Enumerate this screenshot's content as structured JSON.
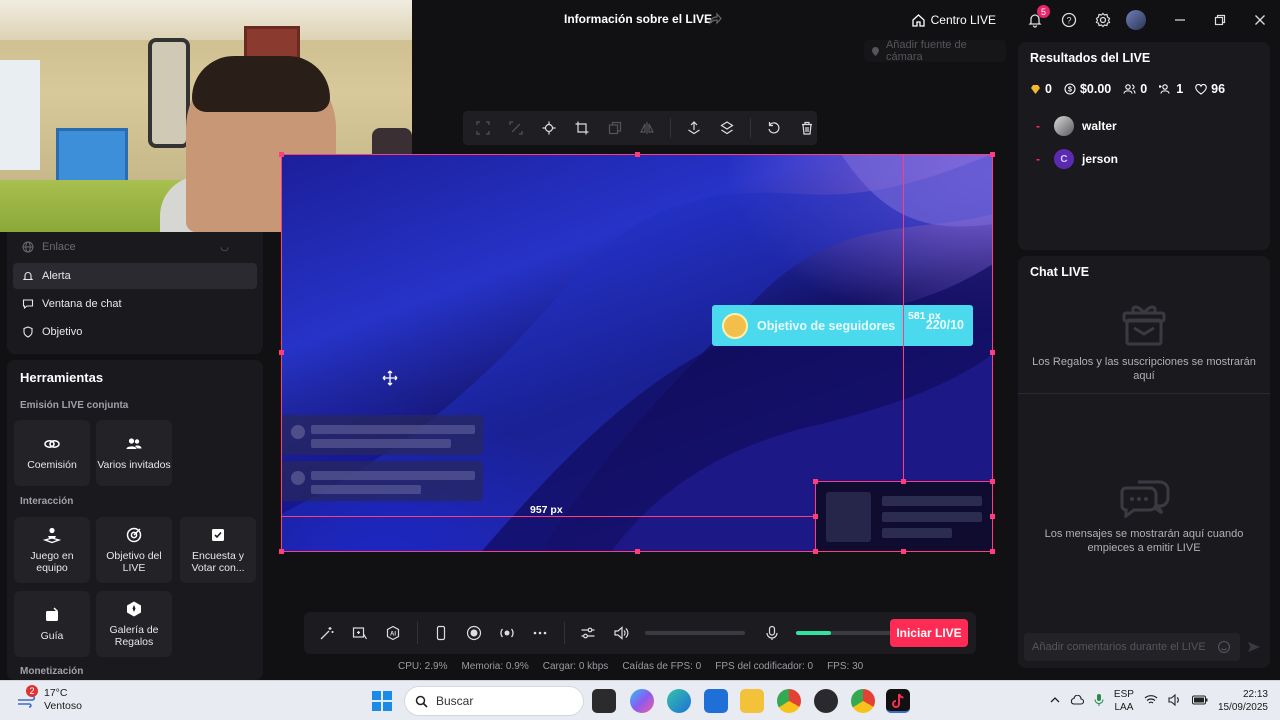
{
  "titlebar": {
    "title": "Información sobre el LIVE",
    "centro_label": "Centro LIVE",
    "notifications_count": "5"
  },
  "left_panel": {
    "menu": [
      {
        "label": "Enlace",
        "state": "dim"
      },
      {
        "label": "Alerta",
        "state": "active"
      },
      {
        "label": "Ventana de chat",
        "state": "normal"
      },
      {
        "label": "Objetivo",
        "state": "normal"
      }
    ],
    "tools_title": "Herramientas",
    "section_coemision": "Emisión LIVE conjunta",
    "tool_coemision": "Coemisión",
    "tool_varios": "Varios invitados",
    "section_interaccion": "Interacción",
    "tool_juego": "Juego en equipo",
    "tool_objetivo": "Objetivo del LIVE",
    "tool_encuesta": "Encuesta y Votar con...",
    "tool_guia": "Guía",
    "tool_galeria": "Galería de Regalos",
    "section_monetizacion": "Monetización"
  },
  "canvas": {
    "camera_source": "Añadir fuente de cámara",
    "goal_title": "Objetivo de seguidores",
    "goal_count": "220/10",
    "measure_vertical": "581 px",
    "measure_horizontal": "957 px"
  },
  "controls": {
    "start_label": "Iniciar LIVE",
    "mic_level": 0.35
  },
  "stats": {
    "cpu": "CPU:  2.9%",
    "memory": "Memoria:  0.9%",
    "upload": "Cargar:  0 kbps",
    "fps_drops": "Caídas de FPS:  0",
    "encoder_fps": "FPS del codificador:  0",
    "fps": "FPS:  30"
  },
  "results": {
    "title": "Resultados del LIVE",
    "diamonds": "0",
    "money": "$0.00",
    "viewers": "0",
    "followers": "1",
    "likes": "96",
    "users": [
      {
        "name": "walter",
        "initial": ""
      },
      {
        "name": "jerson",
        "initial": "C"
      }
    ]
  },
  "chat": {
    "title": "Chat LIVE",
    "gifts_msg": "Los Regalos y las suscripciones se mostrarán aquí",
    "messages_msg": "Los mensajes se mostrarán aquí cuando empieces a emitir LIVE",
    "input_placeholder": "Añadir comentarios durante el LIVE"
  },
  "taskbar": {
    "weather_badge": "2",
    "temperature": "17°C",
    "weather_desc": "Ventoso",
    "search_placeholder": "Buscar",
    "lang_1": "ESP",
    "lang_2": "LAA",
    "time": "22:13",
    "date": "15/09/2025"
  },
  "colors": {
    "accent": "#fe2c55",
    "selection": "#ff3d7a",
    "goal_widget": "#4bd9ee",
    "mic_level": "#2fe3a0"
  }
}
